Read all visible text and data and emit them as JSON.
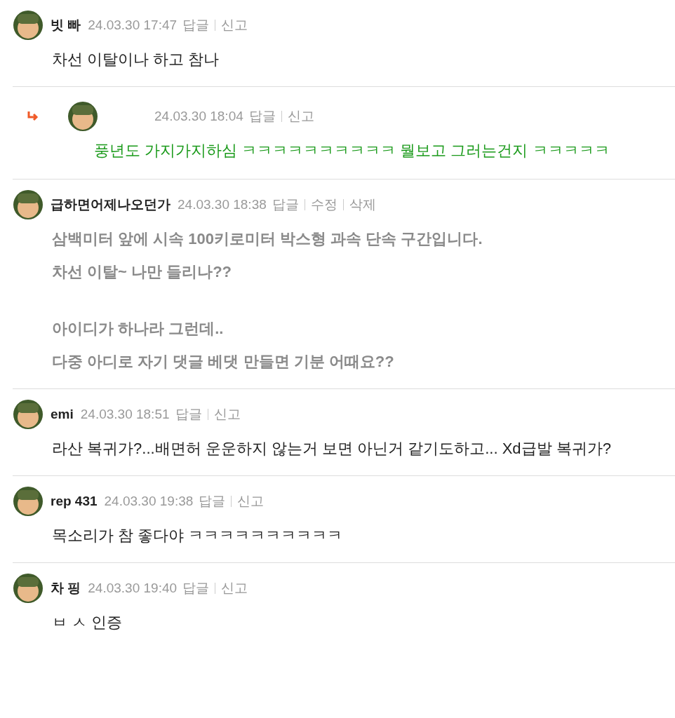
{
  "comments": [
    {
      "kind": "normal",
      "reply": false,
      "author": "빗 빠",
      "date": "24.03.30 17:47",
      "actions": [
        "답글",
        "신고"
      ],
      "paragraphs": [
        [
          "차선 이탈이나 하고 참나"
        ]
      ]
    },
    {
      "kind": "highlight",
      "reply": true,
      "date": "24.03.30 18:04",
      "actions": [
        "답글",
        "신고"
      ],
      "paragraphs": [
        [
          "풍년도 가지가지하심 ㅋㅋㅋㅋㅋㅋㅋㅋㅋㅋ 뭘보고 그러는건지 ㅋㅋㅋㅋㅋ"
        ]
      ]
    },
    {
      "kind": "own",
      "reply": false,
      "author": "급하면어제나오던가",
      "date": "24.03.30 18:38",
      "actions": [
        "답글",
        "수정",
        "삭제"
      ],
      "paragraphs": [
        [
          "삼백미터 앞에 시속 100키로미터 박스형 과속 단속 구간입니다.",
          "차선 이탈~ 나만 들리나??"
        ],
        [
          "아이디가 하나라 그런데..",
          "다중 아디로 자기 댓글 베댓 만들면 기분 어때요??"
        ]
      ]
    },
    {
      "kind": "normal",
      "reply": false,
      "author": "emi",
      "date": "24.03.30 18:51",
      "actions": [
        "답글",
        "신고"
      ],
      "paragraphs": [
        [
          "라산 복귀가?...배면허 운운하지 않는거 보면 아닌거 같기도하고... Xd급발 복귀가?"
        ]
      ]
    },
    {
      "kind": "normal",
      "reply": false,
      "author": "rep 431",
      "date": "24.03.30 19:38",
      "actions": [
        "답글",
        "신고"
      ],
      "paragraphs": [
        [
          "목소리가 참 좋다야 ㅋㅋㅋㅋㅋㅋㅋㅋㅋㅋ"
        ]
      ]
    },
    {
      "kind": "normal",
      "reply": false,
      "author": "차 핑",
      "date": "24.03.30 19:40",
      "actions": [
        "답글",
        "신고"
      ],
      "paragraphs": [
        [
          "ㅂ ㅅ 인증"
        ]
      ]
    }
  ]
}
